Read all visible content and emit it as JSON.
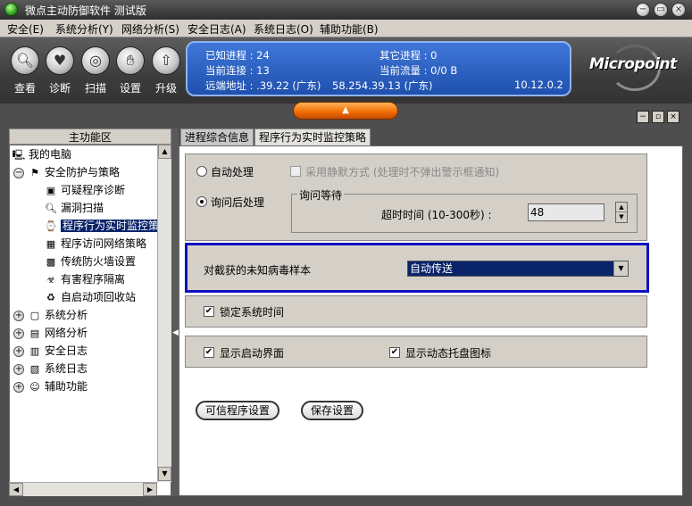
{
  "window": {
    "title": "微点主动防御软件  测试版",
    "controls": {
      "minimize": "−",
      "restore": "▭",
      "close": "×"
    }
  },
  "menu": [
    "安全(E)",
    "系统分析(Y)",
    "网络分析(S)",
    "安全日志(A)",
    "系统日志(O)",
    "辅助功能(B)"
  ],
  "toolbar": {
    "buttons": [
      {
        "label": "查看",
        "icon": "magnifier-icon"
      },
      {
        "label": "诊断",
        "icon": "heart-icon"
      },
      {
        "label": "扫描",
        "icon": "scan-icon"
      },
      {
        "label": "设置",
        "icon": "hand-icon"
      },
      {
        "label": "升级",
        "icon": "upgrade-icon"
      }
    ]
  },
  "status": {
    "known_proc": "已知进程 : 24",
    "other_proc": "其它进程 : 0",
    "cur_conn": "当前连接 : 13",
    "cur_flow": "当前流量 : 0/0 B",
    "remote": "远端地址 : .39.22 (广东)",
    "remote2": "58.254.39.13 (广东)",
    "version": "10.12.0.2"
  },
  "logo": "Micropoint",
  "left": {
    "header": "主功能区",
    "tree": {
      "root": "我的电脑",
      "security": "安全防护与策略",
      "items": [
        "可疑程序诊断",
        "漏洞扫描",
        "程序行为实时监控策",
        "程序访问网络策略",
        "传统防火墙设置",
        "有害程序隔离",
        "自启动项回收站"
      ],
      "others": [
        "系统分析",
        "网络分析",
        "安全日志",
        "系统日志",
        "辅助功能"
      ]
    }
  },
  "tabs": [
    "进程综合信息",
    "程序行为实时监控策略"
  ],
  "content": {
    "auto_label": "自动处理",
    "silent_label": "采用静默方式 (处理时不弹出警示框通知)",
    "ask_label": "询问后处理",
    "wait_group": "询问等待",
    "timeout_label": "超时时间 (10-300秒) :",
    "timeout_value": "48",
    "sample_label": "对截获的未知病毒样本",
    "sample_value": "自动传送",
    "lock_time": "锁定系统时间",
    "show_splash": "显示启动界面",
    "show_tray": "显示动态托盘图标",
    "btn_trusted": "可信程序设置",
    "btn_save": "保存设置"
  },
  "colors": {
    "highlight": "#0a246a",
    "frame": "#1010c0",
    "status_blue": "#2f64c6",
    "accent_orange": "#f06a00"
  }
}
